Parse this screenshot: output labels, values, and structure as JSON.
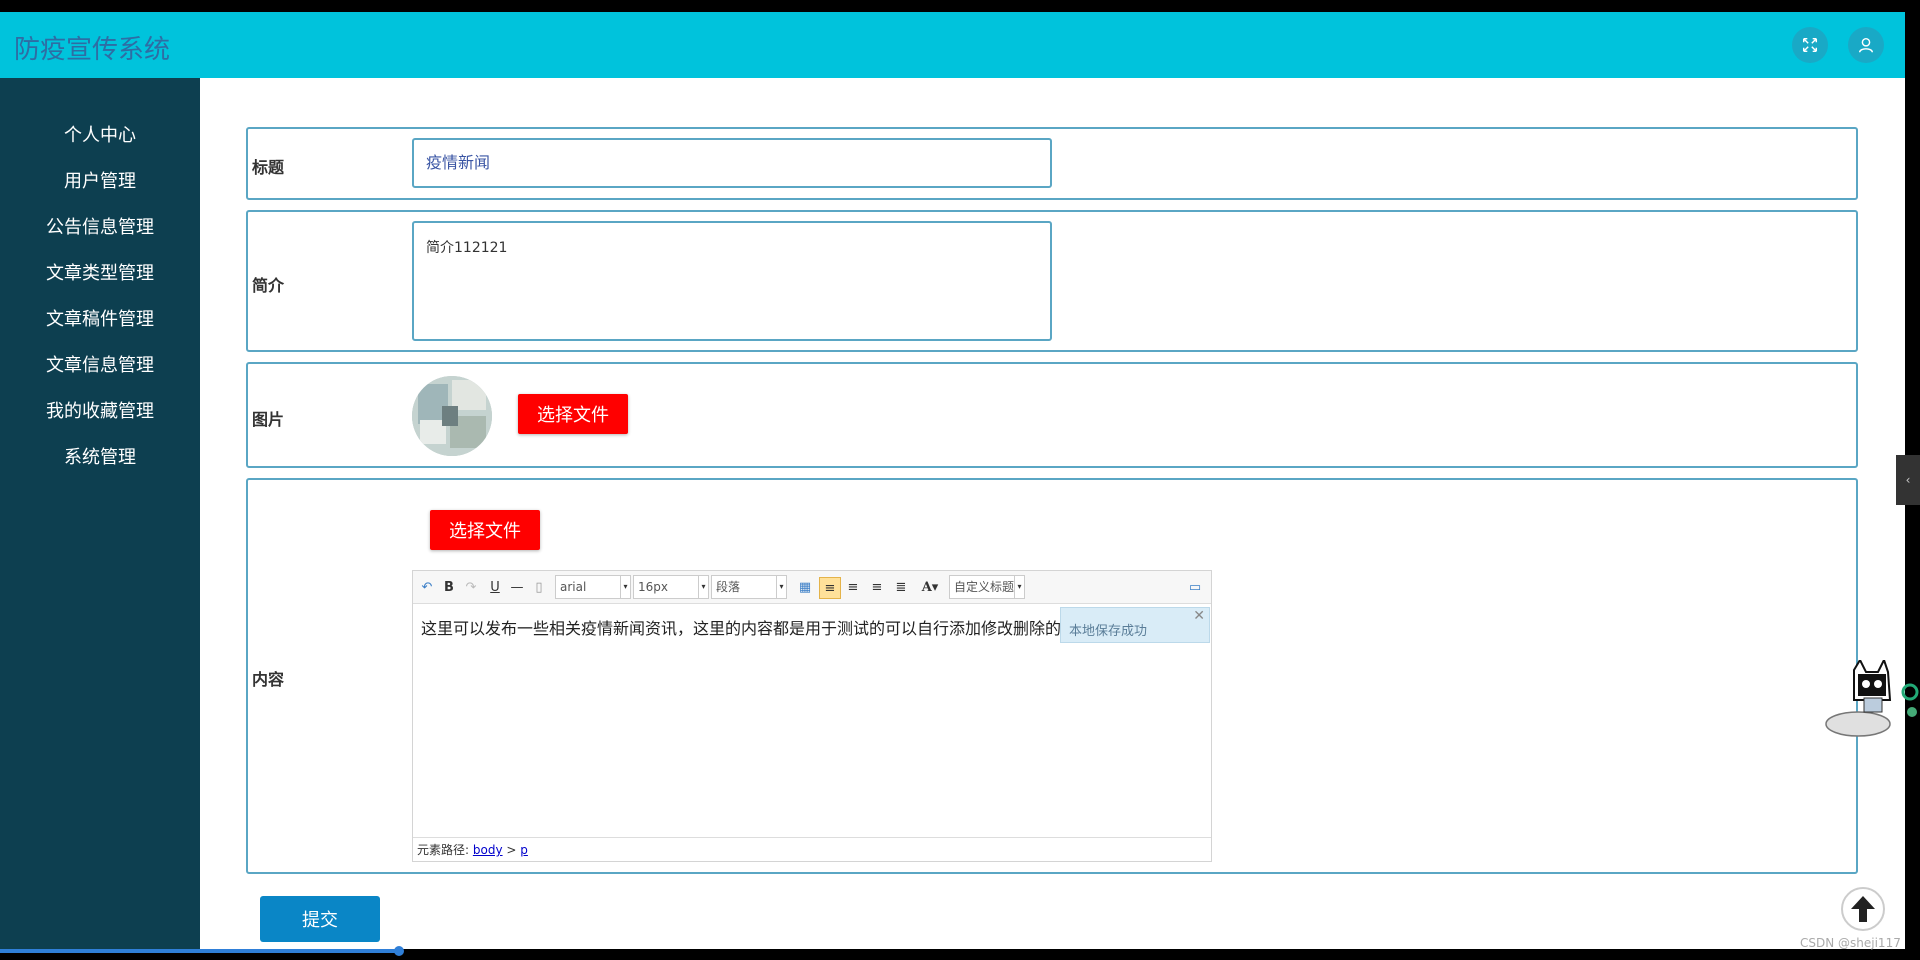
{
  "app": {
    "title": "防疫宣传系统"
  },
  "sidebar": {
    "items": [
      {
        "label": "个人中心"
      },
      {
        "label": "用户管理"
      },
      {
        "label": "公告信息管理"
      },
      {
        "label": "文章类型管理"
      },
      {
        "label": "文章稿件管理"
      },
      {
        "label": "文章信息管理"
      },
      {
        "label": "我的收藏管理"
      },
      {
        "label": "系统管理"
      }
    ]
  },
  "form": {
    "title_label": "标题",
    "title_value": "疫情新闻",
    "intro_label": "简介",
    "intro_value": "简介112121",
    "image_label": "图片",
    "image_button": "选择文件",
    "content_label": "内容",
    "content_button": "选择文件",
    "submit_label": "提交"
  },
  "editor": {
    "font_family": "arial",
    "font_size": "16px",
    "paragraph": "段落",
    "custom_heading": "自定义标题",
    "body_text": "这里可以发布一些相关疫情新闻资讯，这里的内容都是用于测试的可以自行添加修改删除的",
    "toast": "本地保存成功",
    "path_label": "元素路径:",
    "path_body": "body",
    "path_sep": ">",
    "path_p": "p"
  },
  "watermark": "CSDN @sheji117"
}
